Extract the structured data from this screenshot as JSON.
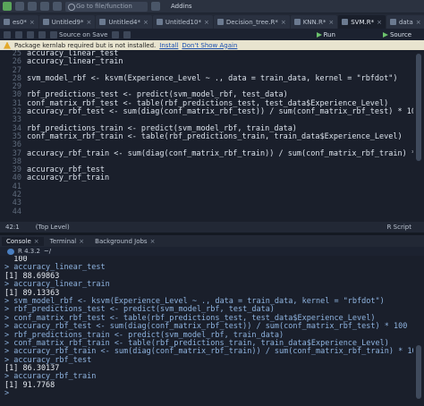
{
  "toolbar": {
    "goto_placeholder": "Go to file/function",
    "addins_label": "Addins"
  },
  "tabs": [
    {
      "label": "es0*",
      "active": false
    },
    {
      "label": "Untitled9*",
      "active": false
    },
    {
      "label": "Untitled4*",
      "active": false
    },
    {
      "label": "Untitled10*",
      "active": false
    },
    {
      "label": "Decision_tree.R*",
      "active": false
    },
    {
      "label": "KNN.R*",
      "active": false
    },
    {
      "label": "SVM.R*",
      "active": true
    },
    {
      "label": "data",
      "active": false
    }
  ],
  "editor_toolbar": {
    "source_on_save": "Source on Save",
    "run_label": "Run",
    "source_label": "Source"
  },
  "warning": {
    "message": "Package kernlab required but is not installed.",
    "install_link": "Install",
    "dont_show_link": "Don't Show Again"
  },
  "editor": {
    "lines": [
      {
        "n": "25",
        "code": "accuracy_linear_test"
      },
      {
        "n": "26",
        "code": "accuracy_linear_train"
      },
      {
        "n": "27",
        "code": ""
      },
      {
        "n": "28",
        "code": "svm_model_rbf <- ksvm(Experience_Level ~ ., data = train_data, kernel = \"rbfdot\")"
      },
      {
        "n": "29",
        "code": ""
      },
      {
        "n": "30",
        "code": "rbf_predictions_test <- predict(svm_model_rbf, test_data)"
      },
      {
        "n": "31",
        "code": "conf_matrix_rbf_test <- table(rbf_predictions_test, test_data$Experience_Level)"
      },
      {
        "n": "32",
        "code": "accuracy_rbf_test <- sum(diag(conf_matrix_rbf_test)) / sum(conf_matrix_rbf_test) * 100"
      },
      {
        "n": "33",
        "code": ""
      },
      {
        "n": "34",
        "code": "rbf_predictions_train <- predict(svm_model_rbf, train_data)"
      },
      {
        "n": "35",
        "code": "conf_matrix_rbf_train <- table(rbf_predictions_train, train_data$Experience_Level)"
      },
      {
        "n": "36",
        "code": ""
      },
      {
        "n": "37",
        "code": "accuracy_rbf_train <- sum(diag(conf_matrix_rbf_train)) / sum(conf_matrix_rbf_train) * 100"
      },
      {
        "n": "38",
        "code": ""
      },
      {
        "n": "39",
        "code": "accuracy_rbf_test"
      },
      {
        "n": "40",
        "code": "accuracy_rbf_train"
      },
      {
        "n": "41",
        "code": ""
      },
      {
        "n": "42",
        "code": ""
      },
      {
        "n": "43",
        "code": ""
      },
      {
        "n": "44",
        "code": ""
      }
    ]
  },
  "status": {
    "position": "42:1",
    "scope": "(Top Level)",
    "file_type": "R Script"
  },
  "console_tabs": [
    {
      "label": "Console",
      "active": true
    },
    {
      "label": "Terminal",
      "active": false
    },
    {
      "label": "Background Jobs",
      "active": false
    }
  ],
  "path_bar": {
    "r_version": "R 4.3.2",
    "path": "~/"
  },
  "console": {
    "lines": [
      {
        "type": "out",
        "text": "  100"
      },
      {
        "type": "cmd",
        "text": "> accuracy_linear_test"
      },
      {
        "type": "out",
        "text": "[1] 88.69863"
      },
      {
        "type": "cmd",
        "text": "> accuracy_linear_train"
      },
      {
        "type": "out",
        "text": "[1] 89.13363"
      },
      {
        "type": "cmd",
        "text": "> svm_model_rbf <- ksvm(Experience_Level ~ ., data = train_data, kernel = \"rbfdot\")"
      },
      {
        "type": "cmd",
        "text": "> rbf_predictions_test <- predict(svm_model_rbf, test_data)"
      },
      {
        "type": "cmd",
        "text": "> conf_matrix_rbf_test <- table(rbf_predictions_test, test_data$Experience_Level)"
      },
      {
        "type": "cmd",
        "text": "> accuracy_rbf_test <- sum(diag(conf_matrix_rbf_test)) / sum(conf_matrix_rbf_test) * 100"
      },
      {
        "type": "cmd",
        "text": "> rbf_predictions_train <- predict(svm_model_rbf, train_data)"
      },
      {
        "type": "cmd",
        "text": "> conf_matrix_rbf_train <- table(rbf_predictions_train, train_data$Experience_Level)"
      },
      {
        "type": "cmd",
        "text": "> accuracy_rbf_train <- sum(diag(conf_matrix_rbf_train)) / sum(conf_matrix_rbf_train) * 100"
      },
      {
        "type": "cmd",
        "text": "> accuracy_rbf_test"
      },
      {
        "type": "out",
        "text": "[1] 86.30137"
      },
      {
        "type": "cmd",
        "text": "> accuracy_rbf_train"
      },
      {
        "type": "out",
        "text": "[1] 91.7768"
      },
      {
        "type": "cmd",
        "text": "> "
      }
    ]
  }
}
